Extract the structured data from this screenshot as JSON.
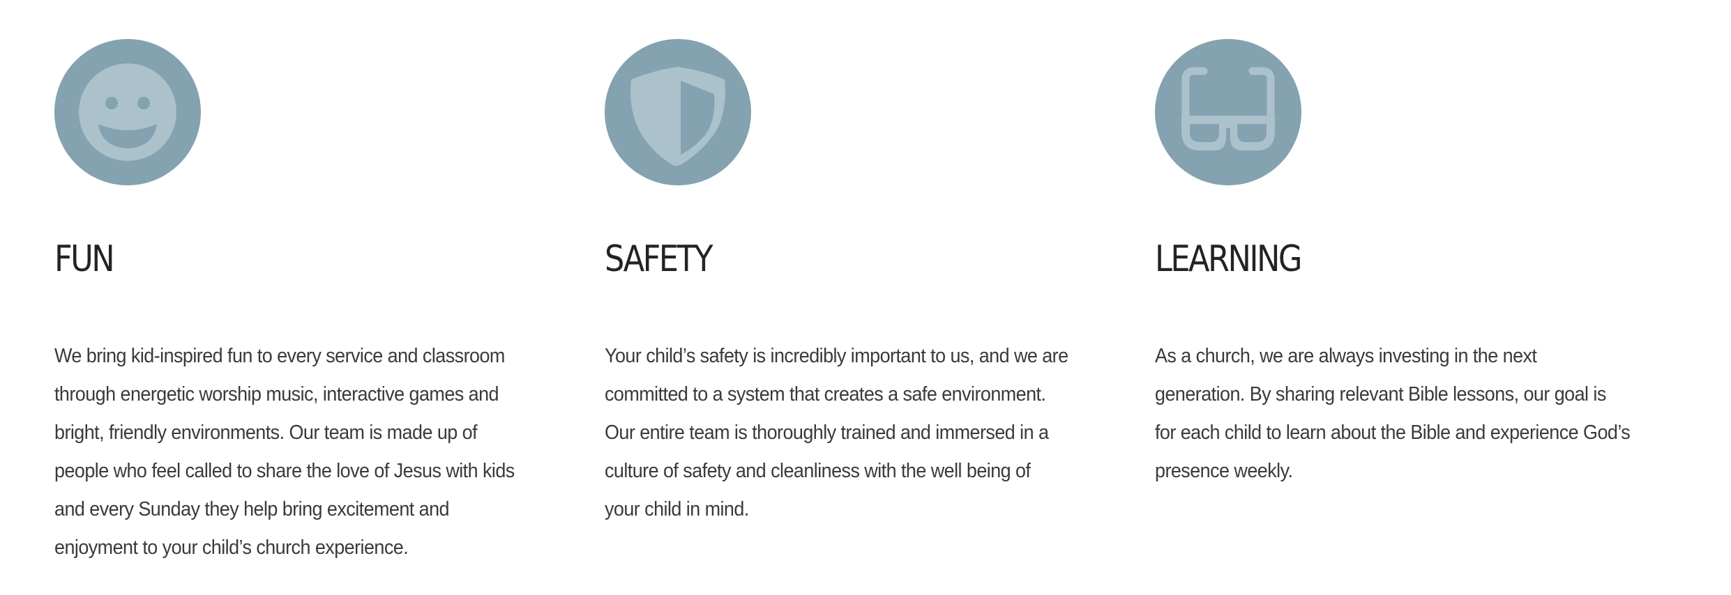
{
  "colors": {
    "icon_circle": "#84a2b0",
    "icon_glyph": "#abc2cd",
    "heading": "#232323",
    "body_text": "#3a3a3a",
    "background": "#ffffff"
  },
  "features": [
    {
      "icon": "smiley-face-icon",
      "title": "FUN",
      "lines": [
        "We bring kid-inspired fun to every service and classroom",
        "through energetic worship music, interactive games and",
        "bright, friendly environments. Our team is made up of",
        "people who feel called to share the love of Jesus with kids",
        "and every Sunday they help bring excitement and",
        "enjoyment to your child’s church experience."
      ]
    },
    {
      "icon": "shield-icon",
      "title": "SAFETY",
      "lines": [
        "Your child’s safety is incredibly important to us, and we are",
        "committed to a system that creates a safe environment.",
        "Our entire team is thoroughly trained and immersed in a",
        "culture of safety and cleanliness with the well being of",
        "your child in mind."
      ]
    },
    {
      "icon": "glasses-icon",
      "title": "LEARNING",
      "lines": [
        "As a church, we are always investing in the next",
        "generation. By sharing relevant Bible lessons, our goal is",
        "for each child to learn about the Bible and experience God’s",
        "presence weekly."
      ]
    }
  ]
}
